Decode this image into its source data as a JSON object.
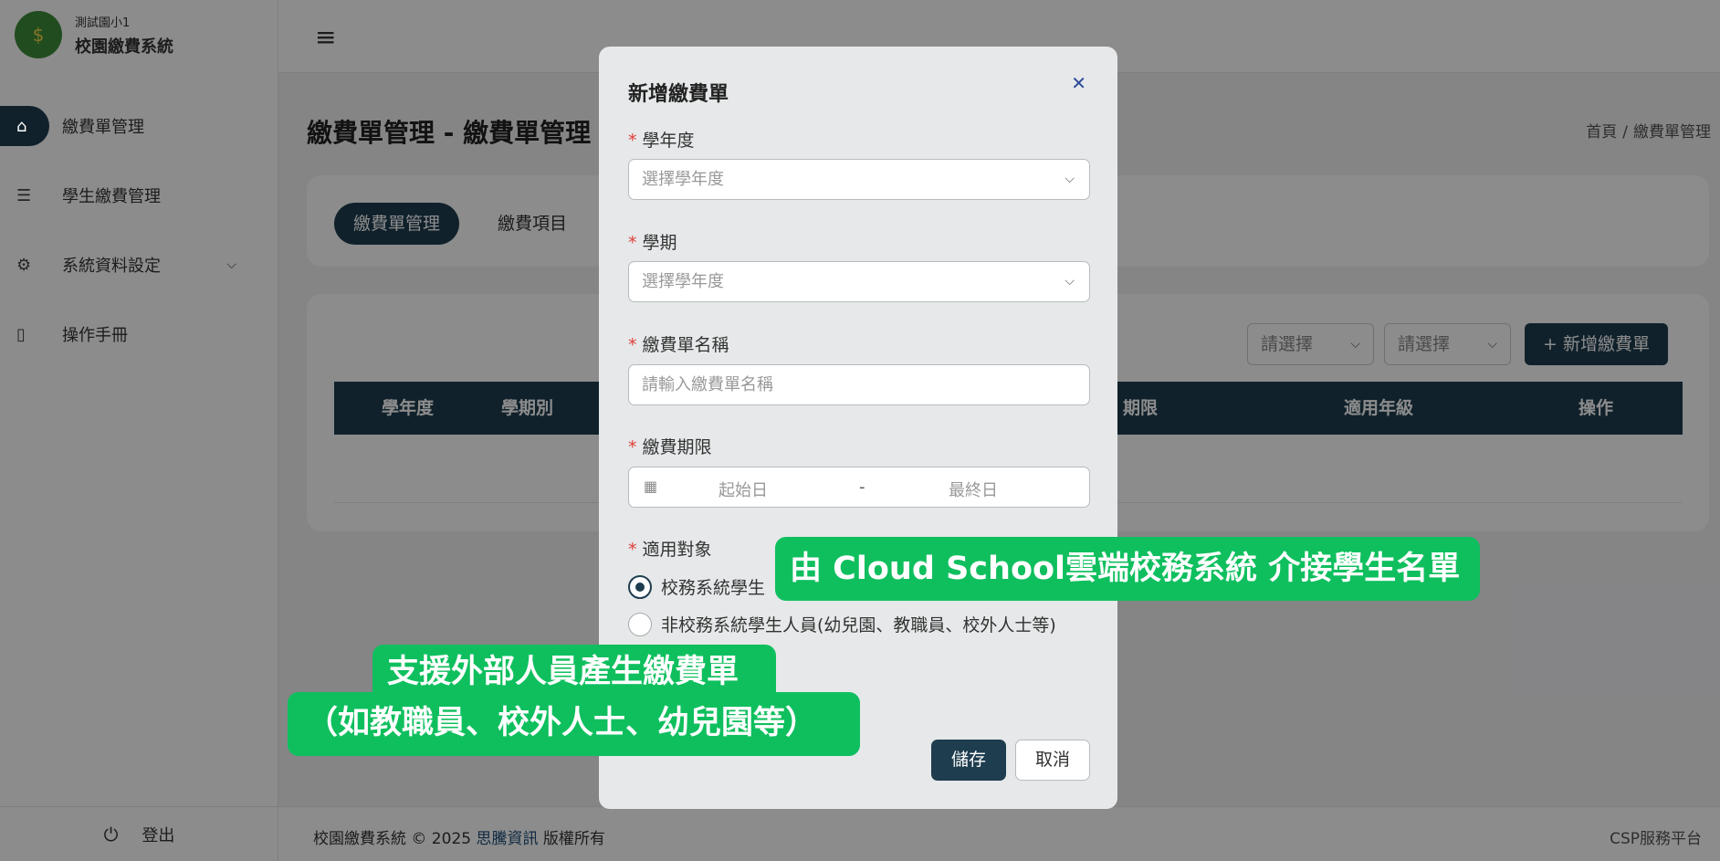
{
  "brand": {
    "school": "測試園小1",
    "system": "校園繳費系統"
  },
  "sidebar": {
    "items": [
      {
        "label": "繳費單管理",
        "icon": "home-icon",
        "active": true
      },
      {
        "label": "學生繳費管理",
        "icon": "database-icon"
      },
      {
        "label": "系統資料設定",
        "icon": "gear-icon",
        "expandable": true
      },
      {
        "label": "操作手冊",
        "icon": "book-icon"
      }
    ],
    "logout": "登出"
  },
  "header": {
    "menu_icon": "hamburger-icon"
  },
  "page": {
    "title": "繳費單管理 - 繳費單管理",
    "breadcrumb": [
      "首頁",
      "繳費單管理"
    ],
    "breadcrumb_sep": "/",
    "tabs": [
      "繳費單管理",
      "繳費項目"
    ],
    "filters": [
      "請選擇",
      "請選擇"
    ],
    "add_button": "+ 新增繳費單",
    "table_headers": [
      "學年度",
      "學期別",
      "期限",
      "適用年級",
      "操作"
    ]
  },
  "footer": {
    "copyright_prefix": "校園繳費系統 © 2025",
    "company": "思騰資訊",
    "copyright_suffix": "版權所有",
    "platform": "CSP服務平台"
  },
  "modal": {
    "title": "新增繳費單",
    "required_mark": "*",
    "fields": {
      "year": {
        "label": "學年度",
        "placeholder": "選擇學年度"
      },
      "term": {
        "label": "學期",
        "placeholder": "選擇學年度"
      },
      "name": {
        "label": "繳費單名稱",
        "placeholder": "請輸入繳費單名稱"
      },
      "period": {
        "label": "繳費期限",
        "start": "起始日",
        "separator": "-",
        "end": "最終日"
      },
      "target": {
        "label": "適用對象",
        "options": [
          "校務系統學生",
          "非校務系統學生人員(幼兒園、教職員、校外人士等)"
        ],
        "selected": 0
      }
    },
    "save": "儲存",
    "cancel": "取消"
  },
  "callouts": {
    "one": "由 Cloud School雲端校務系統 介接學生名單",
    "two_line1": "支援外部人員產生繳費單",
    "two_line2": "（如教職員、校外人士、幼兒園等）"
  },
  "colors": {
    "primary": "#1e3d4f",
    "callout": "#0fbf5e",
    "required": "#e0403a"
  }
}
